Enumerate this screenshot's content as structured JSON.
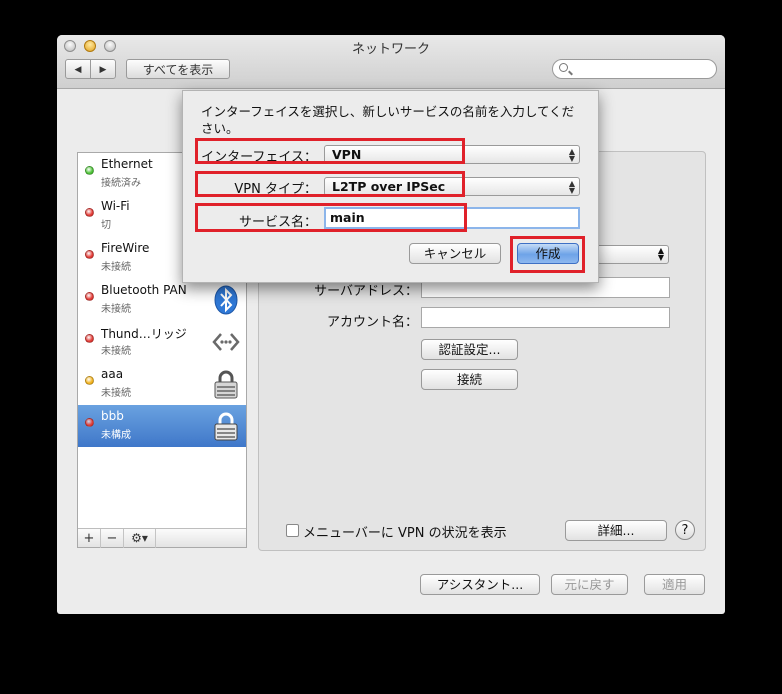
{
  "window": {
    "title": "ネットワーク",
    "show_all": "すべてを表示",
    "search_placeholder": ""
  },
  "toolbar": {
    "back": "◀",
    "forward": "▶"
  },
  "sidebar": {
    "items": [
      {
        "name": "Ethernet",
        "status": "接続済み",
        "dot_color": "#4cc236",
        "icon": "ethernet-icon"
      },
      {
        "name": "Wi-Fi",
        "status": "切",
        "dot_color": "#e23a35",
        "icon": "wifi-icon"
      },
      {
        "name": "FireWire",
        "status": "未接続",
        "dot_color": "#e23a35",
        "icon": "firewire-icon"
      },
      {
        "name": "Bluetooth PAN",
        "status": "未接続",
        "dot_color": "#e23a35",
        "icon": "bluetooth-icon"
      },
      {
        "name": "Thund…リッジ",
        "status": "未接続",
        "dot_color": "#e23a35",
        "icon": "thunderbolt-bridge-icon"
      },
      {
        "name": "aaa",
        "status": "未接続",
        "dot_color": "#f2b21c",
        "icon": "lock-icon"
      },
      {
        "name": "bbb",
        "status": "未構成",
        "dot_color": "#e23a35",
        "icon": "lock-icon"
      }
    ],
    "add": "+",
    "remove": "−",
    "gear": "⚙▾"
  },
  "pane": {
    "server_label": "サーバアドレス：",
    "server_value": "",
    "account_label": "アカウント名：",
    "account_value": "",
    "auth_button": "認証設定...",
    "connect_button": "接続",
    "menubar_checkbox": "メニューバーに VPN の状況を表示",
    "advanced_button": "詳細...",
    "help": "?"
  },
  "footer": {
    "assistant": "アシスタント...",
    "revert": "元に戻す",
    "apply": "適用"
  },
  "sheet": {
    "instruction": "インターフェイスを選択し、新しいサービスの名前を入力してください。",
    "interface_label": "インターフェイス：",
    "interface_value": "VPN",
    "vpn_type_label": "VPN タイプ：",
    "vpn_type_value": "L2TP over IPSec",
    "service_name_label": "サービス名：",
    "service_name_value": "main",
    "cancel": "キャンセル",
    "create": "作成"
  },
  "colors": {
    "highlight": "#e0212a",
    "selection": "#3f77c9"
  }
}
